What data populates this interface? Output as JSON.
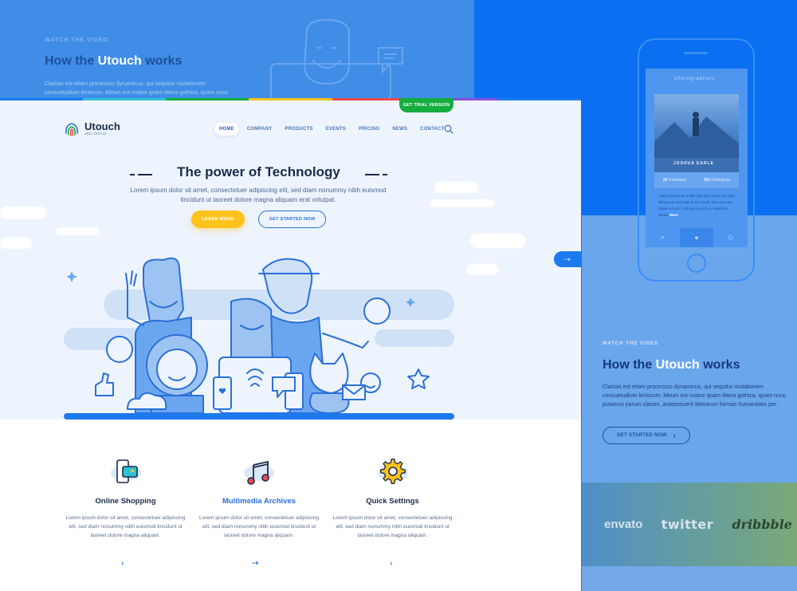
{
  "background": {
    "top_left": {
      "eyebrow": "WATCH THE VIDEO",
      "title_prefix": "How the ",
      "title_accent": "Utouch",
      "title_suffix": " works",
      "paragraph": "Claritas est etiam processus dynamicus, qui sequitur mutationem consuetudium lectorum. Mirum est notare quam littera gothica, quam nunc putamus"
    },
    "video": {
      "eyebrow": "WATCH THE VIDEO",
      "title_prefix": "How the ",
      "title_accent": "Utouch",
      "title_suffix": " works",
      "paragraph": "Claritas est etiam processus dynamicus, qui sequitur mutationem consuetudium lectorum. Mirum est notare quam littera gothica, quam nunc putamus parum claram, anteposuerit litterarum formas humanitatis per.",
      "button_label": "GET STARTED NOW",
      "button_arrow": "›"
    },
    "phone": {
      "header": "photographers",
      "user_name": "JOSHUA EARLE",
      "stats": [
        {
          "value": "2K",
          "label": "Followers"
        },
        {
          "value": "450",
          "label": "Followings"
        }
      ],
      "bio": "I had a dream as a little boy that I hope one day I will get up and explore the world. Now you can follow me as I continue to push to make this dream",
      "bio_more": "More",
      "tabs": [
        "⌕",
        "♥",
        "⚇"
      ]
    },
    "brands": [
      "envato",
      "twitter",
      "dribbble"
    ]
  },
  "site": {
    "trial_button": "GET TRIAL VERSION",
    "logo": {
      "name": "Utouch",
      "tagline": "app startup"
    },
    "nav": [
      "HOME",
      "COMPANY",
      "PRODUCTS",
      "EVENTS",
      "PRICING",
      "NEWS",
      "CONTACT"
    ],
    "hero": {
      "title": "The power of Technology",
      "subtitle": "Lorem ipsum dolor sit amet, consectetuer adipiscing elit, sed diam nonummy nibh euismod tincidunt ut laoreet dolore magna aliquam erat volutpat.",
      "learn_more": "LEARN MORE",
      "get_started": "GET STARTED NOW",
      "next_arrow": "⇢"
    },
    "features": [
      {
        "title": "Online Shopping",
        "text": "Lorem ipsum dolor sit amet, consectetuer adipiscing elit, sed diam nonummy nibh euismod tincidunt ut laoreet dolore magna aliquam.",
        "arrow": "›"
      },
      {
        "title": "Multimedia Archives",
        "text": "Lorem ipsum dolor sit amet, consectetuer adipiscing elit, sed diam nonummy nibh euismod tincidunt ut laoreet dolore magna aliquam.",
        "arrow": "⇢"
      },
      {
        "title": "Quick Settings",
        "text": "Lorem ipsum dolor sit amet, consectetuer adipiscing elit, sed diam nonummy nibh euismod tincidunt ut laoreet dolore magna aliquam.",
        "arrow": "›"
      }
    ]
  },
  "colors": {
    "accent_blue": "#2a70d8",
    "trial_green": "#15ad3e",
    "learn_yellow": "#ffc21a",
    "strip": [
      "#1c79ee",
      "#2fc1d6",
      "#15ad3e",
      "#ffc21a",
      "#f24b4b",
      "#8a4fd8",
      "#1c79ee"
    ]
  }
}
